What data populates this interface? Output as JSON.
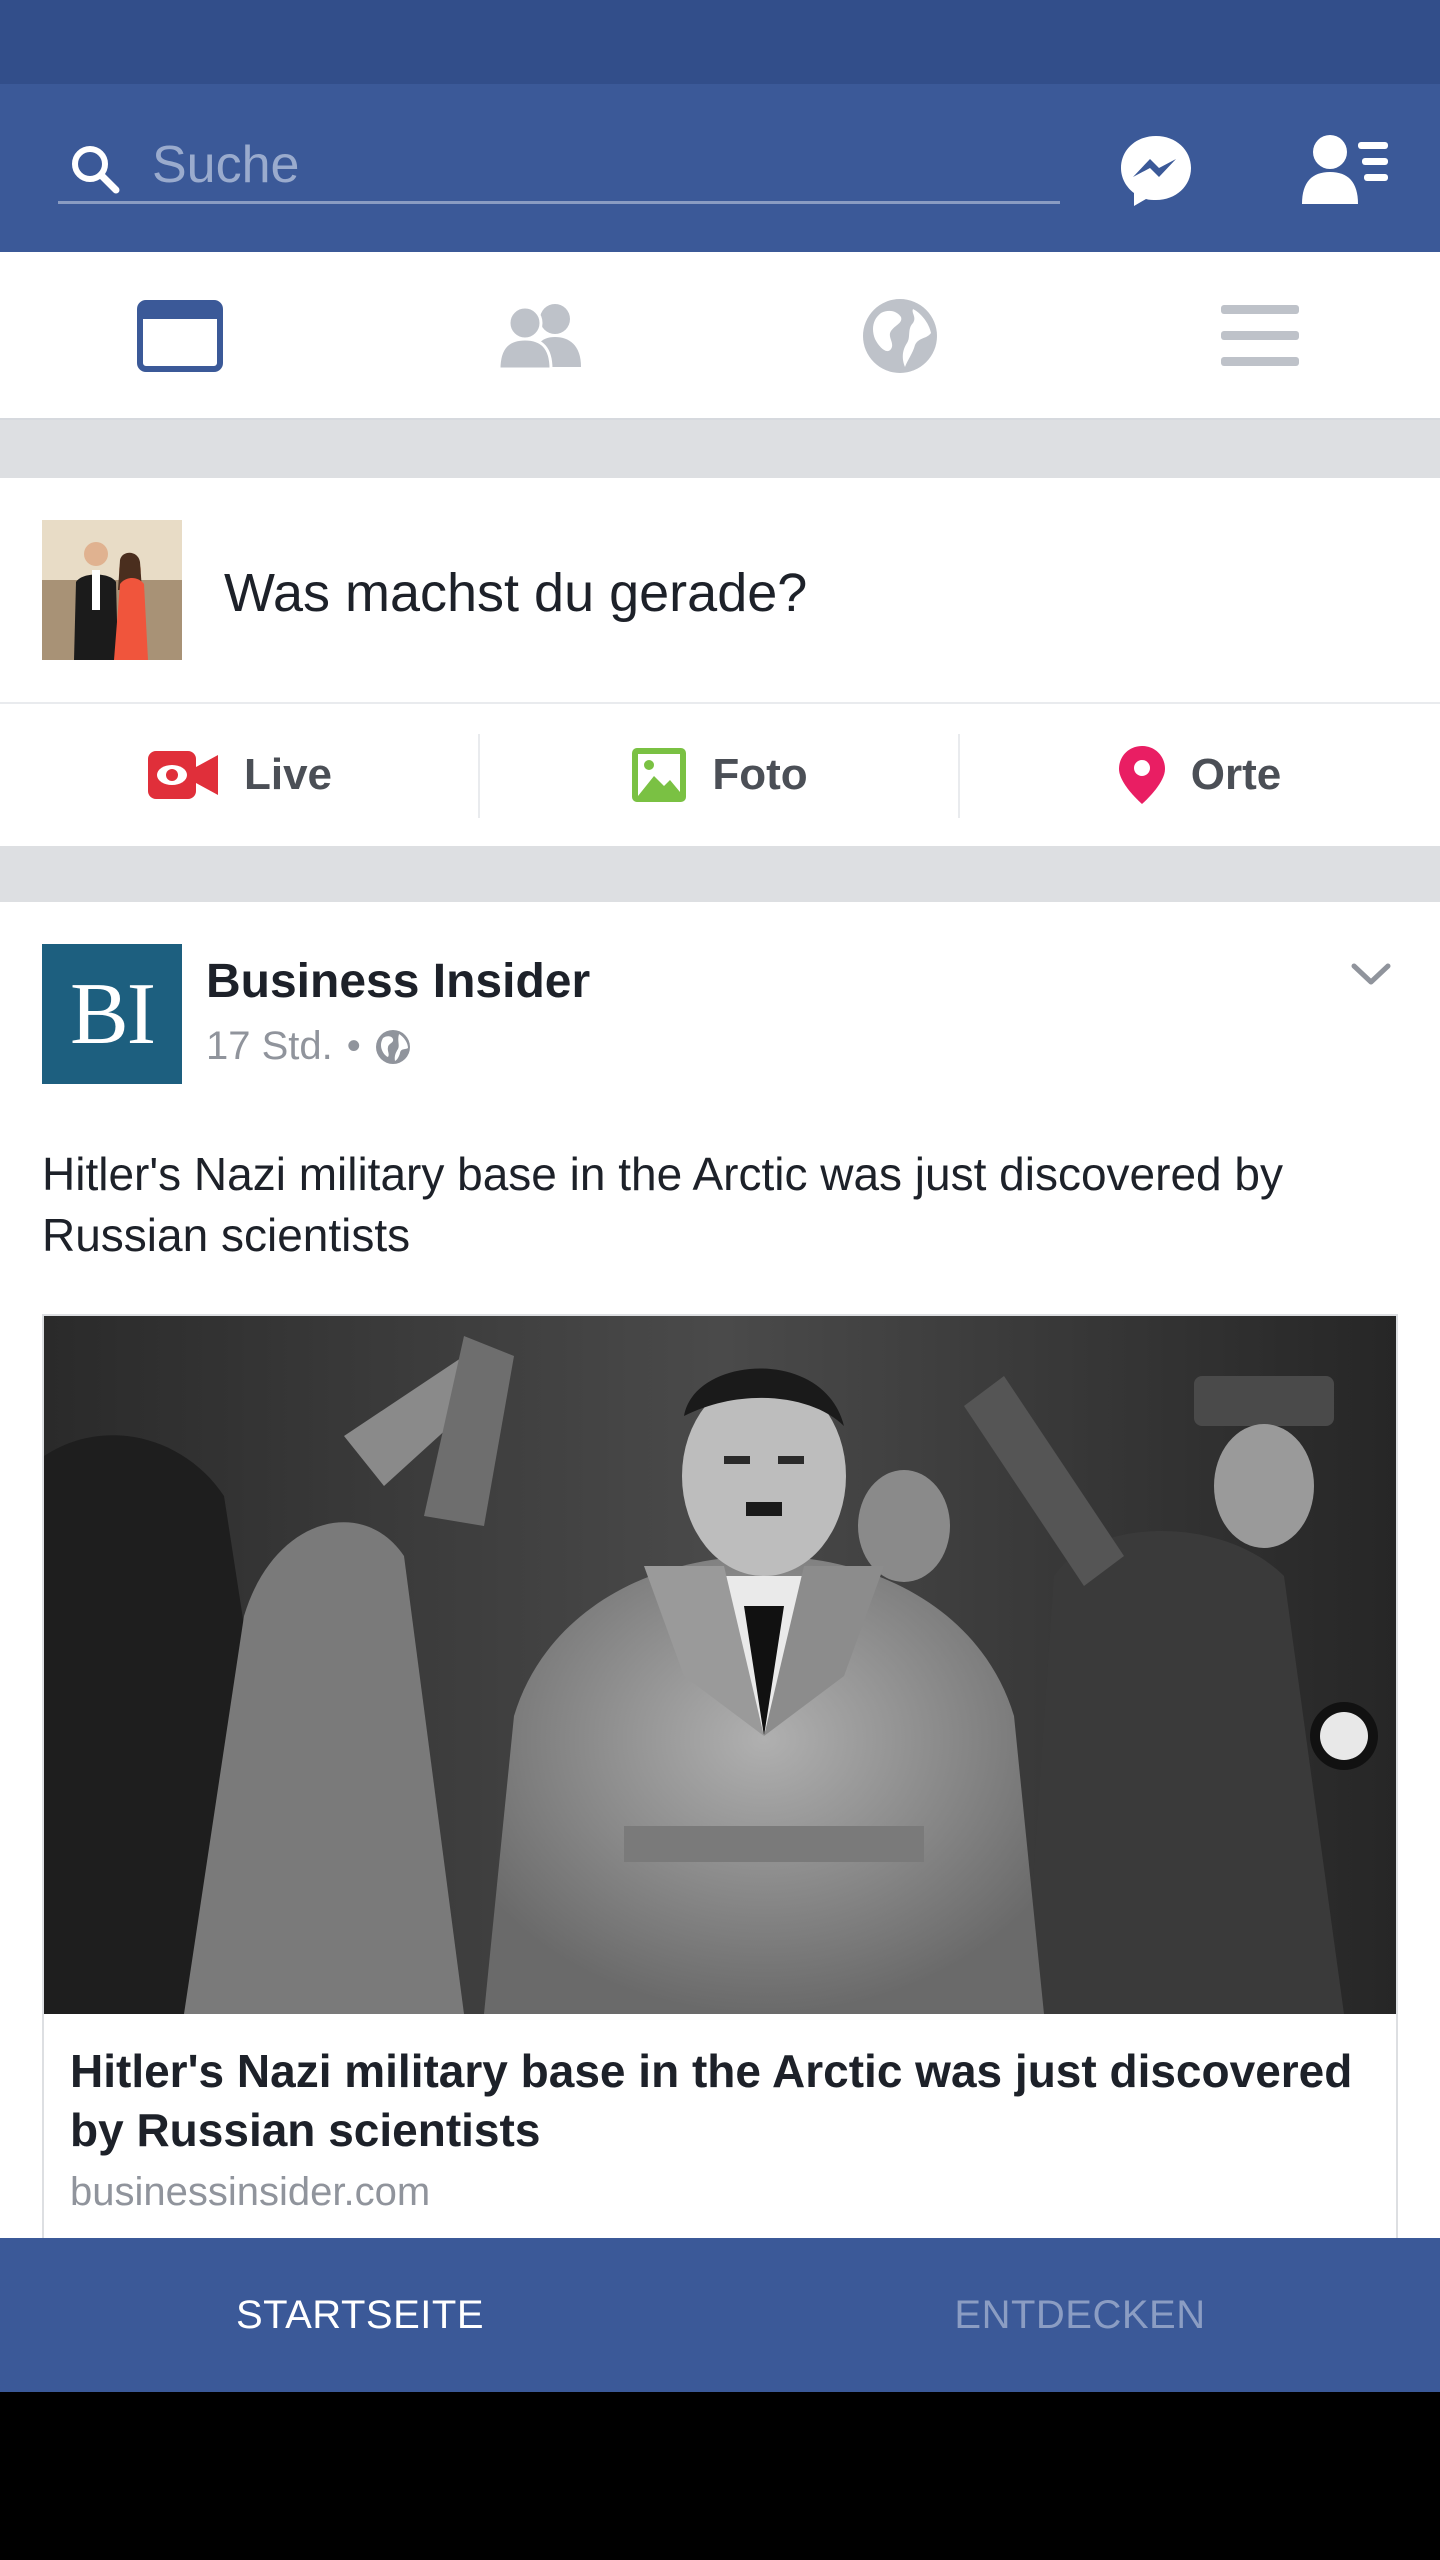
{
  "colors": {
    "brand": "#3b5998",
    "status_bar": "#324e8a",
    "text": "#1d2129",
    "muted": "#90949c",
    "live_red": "#e02f3a",
    "photo_green": "#7ac143",
    "places_pink": "#e91e63"
  },
  "search": {
    "placeholder": "Suche",
    "value": ""
  },
  "top_bar": {
    "icons": [
      "search-icon",
      "messenger-icon",
      "friend-requests-icon"
    ]
  },
  "tabs": [
    {
      "name": "news-feed",
      "icon": "news-feed-icon",
      "active": true
    },
    {
      "name": "friends",
      "icon": "friends-icon",
      "active": false
    },
    {
      "name": "notifications",
      "icon": "globe-icon",
      "active": false
    },
    {
      "name": "menu",
      "icon": "menu-icon",
      "active": false
    }
  ],
  "composer": {
    "prompt": "Was machst du gerade?",
    "actions": [
      {
        "label": "Live",
        "icon": "live-video-icon"
      },
      {
        "label": "Foto",
        "icon": "photo-icon"
      },
      {
        "label": "Orte",
        "icon": "location-pin-icon"
      }
    ]
  },
  "post": {
    "author": "Business Insider",
    "logo_text": "BI",
    "time": "17 Std.",
    "separator": "•",
    "privacy_icon": "globe-icon",
    "text": "Hitler's Nazi military base in the Arctic was just discovered by Russian scientists",
    "link": {
      "title": "Hitler's Nazi military base in the Arctic was just discovered by Russian scientists",
      "domain": "businessinsider.com"
    }
  },
  "bottom_nav": {
    "home": "STARTSEITE",
    "discover": "ENTDECKEN"
  }
}
